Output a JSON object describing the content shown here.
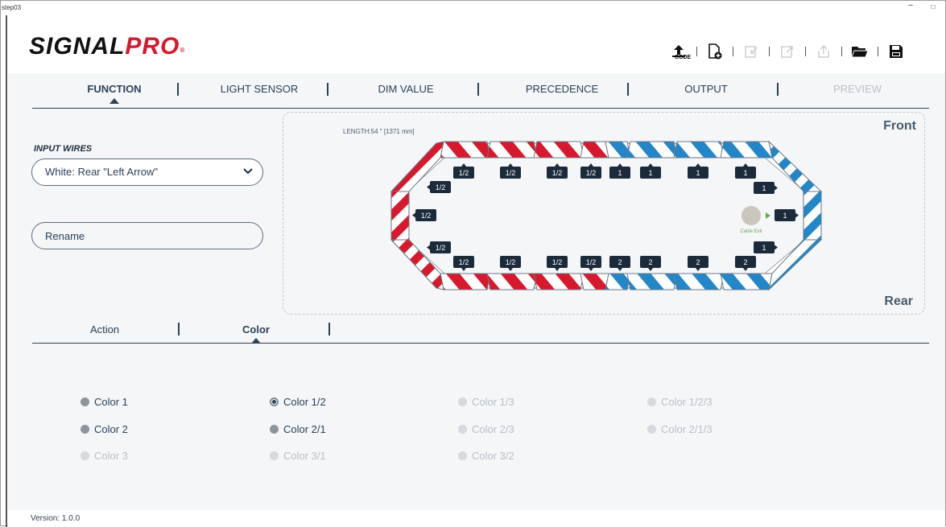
{
  "window": {
    "title": "step03",
    "minimize": "–",
    "maximize": "□"
  },
  "brand": {
    "part1": "SIGNAL",
    "part2": "PRO",
    "reg": "®"
  },
  "toolbar": {
    "code_label": "CODE",
    "icons": [
      "upload-code-icon",
      "new-file-icon",
      "import-icon",
      "export-icon",
      "share-icon",
      "open-folder-icon",
      "save-icon"
    ]
  },
  "nav": {
    "tabs": [
      {
        "label": "FUNCTION",
        "state": "active"
      },
      {
        "label": "LIGHT SENSOR",
        "state": "normal"
      },
      {
        "label": "DIM VALUE",
        "state": "normal"
      },
      {
        "label": "PRECEDENCE",
        "state": "normal"
      },
      {
        "label": "OUTPUT",
        "state": "normal"
      },
      {
        "label": "PREVIEW",
        "state": "disabled"
      }
    ]
  },
  "input_wires": {
    "label": "INPUT WIRES",
    "selected": "White:  Rear \"Left Arrow\"",
    "rename": "Rename"
  },
  "diagram": {
    "front": "Front",
    "rear": "Rear",
    "length": "LENGTH:54 \" [1371 mm]",
    "cable_exit": "Cable Exit",
    "top_badges": [
      "1/2",
      "1/2",
      "1/2",
      "1/2",
      "1",
      "1",
      "1",
      "1"
    ],
    "bottom_badges": [
      "1/2",
      "1/2",
      "1/2",
      "1/2",
      "2",
      "2",
      "2",
      "2"
    ],
    "left_badges": [
      "1/2",
      "1/2",
      "1/2"
    ],
    "right_badges": [
      "1",
      "1",
      "1"
    ],
    "colors": {
      "red": "#d7192d",
      "blue": "#2386c8",
      "badge": "#1c2b3b"
    }
  },
  "subtabs": [
    {
      "label": "Action",
      "state": "normal"
    },
    {
      "label": "Color",
      "state": "active"
    }
  ],
  "color_options": [
    {
      "label": "Color 1",
      "state": "enabled"
    },
    {
      "label": "Color 1/2",
      "state": "selected"
    },
    {
      "label": "Color 1/3",
      "state": "disabled"
    },
    {
      "label": "Color 1/2/3",
      "state": "disabled"
    },
    {
      "label": "Color 2",
      "state": "enabled"
    },
    {
      "label": "Color 2/1",
      "state": "enabled"
    },
    {
      "label": "Color 2/3",
      "state": "disabled"
    },
    {
      "label": "Color 2/1/3",
      "state": "disabled"
    },
    {
      "label": "Color 3",
      "state": "disabled"
    },
    {
      "label": "Color 3/1",
      "state": "disabled"
    },
    {
      "label": "Color 3/2",
      "state": "disabled"
    }
  ],
  "footer": {
    "version": "Version: 1.0.0"
  }
}
